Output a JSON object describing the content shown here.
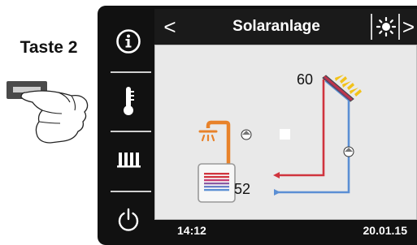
{
  "instruction": {
    "label": "Taste 2"
  },
  "sidebar": {
    "items": [
      {
        "icon": "info-icon"
      },
      {
        "icon": "thermometer-icon"
      },
      {
        "icon": "radiator-icon"
      },
      {
        "icon": "power-icon"
      }
    ]
  },
  "header": {
    "prev_symbol": "<",
    "title": "Solaranlage",
    "mode_icon": "sun-icon",
    "next_symbol": ">"
  },
  "diagram": {
    "collector_temperature": "60",
    "tank_temperature": "52",
    "colors": {
      "supply_line": "#d0343e",
      "return_line": "#5b8fd4",
      "collector_ray": "#f2c21a",
      "tap_water": "#e8822a",
      "background": "#e9e9e9"
    }
  },
  "footer": {
    "time": "14:12",
    "date": "20.01.15"
  }
}
